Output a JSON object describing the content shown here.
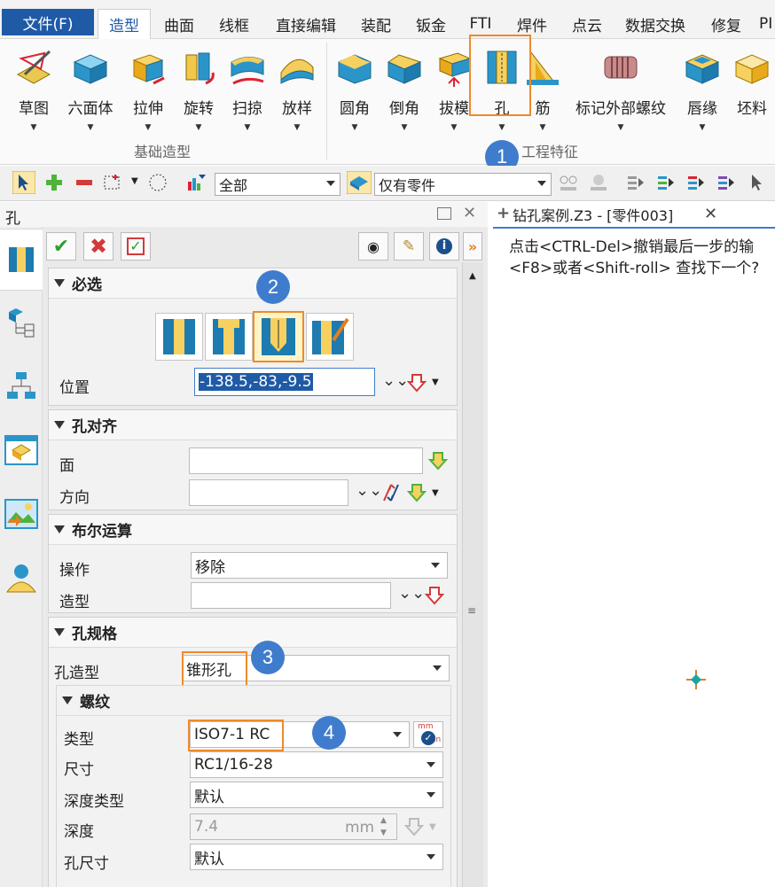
{
  "menu": {
    "file": "文件(F)",
    "tabs": [
      "造型",
      "曲面",
      "线框",
      "直接编辑",
      "装配",
      "钣金",
      "FTI",
      "焊件",
      "点云",
      "数据交换",
      "修复",
      "PI"
    ]
  },
  "ribbon": {
    "basic": [
      "草图",
      "六面体",
      "拉伸",
      "旋转",
      "扫掠",
      "放样"
    ],
    "basic_group": "基础造型",
    "eng": [
      "圆角",
      "倒角",
      "拔模",
      "孔",
      "筋",
      "标记外部螺纹",
      "唇缘",
      "坯料"
    ],
    "eng_group": "工程特征"
  },
  "toolbar": {
    "filter": "全部",
    "scope": "仅有零件"
  },
  "panel": {
    "title": "孔",
    "required": {
      "title": "必选",
      "position_label": "位置",
      "position_value": "-138.5,-83,-9.5"
    },
    "align": {
      "title": "孔对齐",
      "face_label": "面",
      "dir_label": "方向"
    },
    "boolean": {
      "title": "布尔运算",
      "op_label": "操作",
      "op_value": "移除",
      "shape_label": "造型"
    },
    "spec": {
      "title": "孔规格",
      "shape_label": "孔造型",
      "shape_value": "锥形孔",
      "thread": {
        "title": "螺纹",
        "type_label": "类型",
        "type_value": "ISO7-1 RC",
        "size_label": "尺寸",
        "size_value": "RC1/16-28",
        "depth_type_label": "深度类型",
        "depth_type_value": "默认",
        "depth_label": "深度",
        "depth_value": "7.4",
        "depth_unit": "mm",
        "hole_size_label": "孔尺寸",
        "hole_size_value": "默认",
        "units_icon": "mm",
        "units_icon_sub": "in"
      }
    }
  },
  "doc": {
    "tab": "钻孔案例.Z3 - [零件003]",
    "line1": "点击<CTRL-Del>撤销最后一步的输",
    "line2": "<F8>或者<Shift-roll> 查找下一个?"
  },
  "steps": [
    "1",
    "2",
    "3",
    "4"
  ],
  "colors": {
    "accent": "#1f5aa6",
    "highlight": "#ef8a2b",
    "step": "#3f7ccd"
  }
}
